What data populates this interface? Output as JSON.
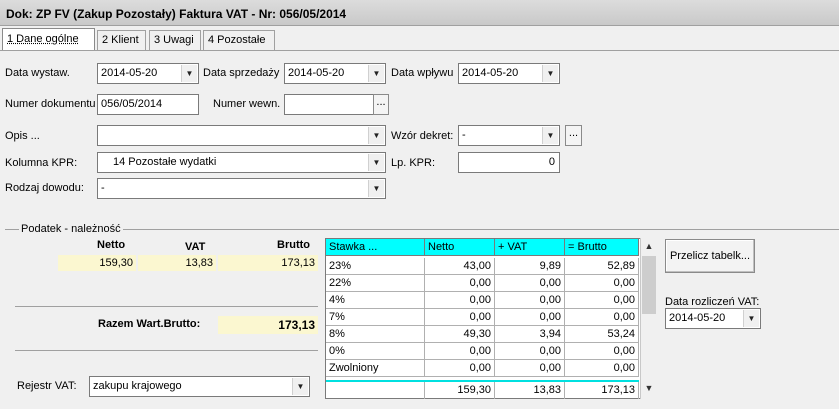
{
  "window": {
    "title": "Dok: ZP FV (Zakup Pozostały)  Faktura VAT  - Nr: 056/05/2014"
  },
  "tabs": [
    {
      "label": "1 Dane ogólne",
      "active": true
    },
    {
      "label": "2 Klient"
    },
    {
      "label": "3 Uwagi"
    },
    {
      "label": "4 Pozostałe"
    }
  ],
  "form": {
    "data_wystaw": {
      "label": "Data wystaw.",
      "value": "2014-05-20"
    },
    "data_sprzedazy": {
      "label": "Data sprzedaży",
      "value": "2014-05-20"
    },
    "data_wplywu": {
      "label": "Data wpływu",
      "value": "2014-05-20"
    },
    "numer_dokumentu": {
      "label": "Numer dokumentu",
      "value": "056/05/2014"
    },
    "numer_wewn": {
      "label": "Numer wewn.",
      "value": ""
    },
    "opis": {
      "label": "Opis ...",
      "value": ""
    },
    "wzor_dekret": {
      "label": "Wzór dekret:",
      "value": "-"
    },
    "kolumna_kpr": {
      "label": "Kolumna KPR:",
      "value": "14  Pozostałe wydatki"
    },
    "lp_kpr": {
      "label": "Lp. KPR:",
      "value": "0"
    },
    "rodzaj_dowodu": {
      "label": "Rodzaj dowodu:",
      "value": "-"
    },
    "ellipsis": "..."
  },
  "podatek": {
    "group_label": "Podatek - należność",
    "headers": {
      "netto": "Netto",
      "vat": "VAT",
      "brutto": "Brutto"
    },
    "values": {
      "netto": "159,30",
      "vat": "13,83",
      "brutto": "173,13"
    },
    "razem_label": "Razem Wart.Brutto:",
    "razem_value": "173,13"
  },
  "rejestr": {
    "label": "Rejestr VAT:",
    "value": "zakupu krajowego"
  },
  "vat_table": {
    "headers": [
      "Stawka ...",
      "Netto",
      "+ VAT",
      "= Brutto"
    ],
    "rows": [
      [
        "23%",
        "43,00",
        "9,89",
        "52,89"
      ],
      [
        "22%",
        "0,00",
        "0,00",
        "0,00"
      ],
      [
        "4%",
        "0,00",
        "0,00",
        "0,00"
      ],
      [
        "7%",
        "0,00",
        "0,00",
        "0,00"
      ],
      [
        "8%",
        "49,30",
        "3,94",
        "53,24"
      ],
      [
        "0%",
        "0,00",
        "0,00",
        "0,00"
      ],
      [
        "Zwolniony",
        "0,00",
        "0,00",
        "0,00"
      ]
    ],
    "totals": [
      "",
      "159,30",
      "13,83",
      "173,13"
    ],
    "header_color": "#00ffff"
  },
  "przelicz_button": "Przelicz tabelk...",
  "data_rozliczen": {
    "label": "Data rozliczeń VAT:",
    "value": "2014-05-20"
  },
  "icons": {
    "dropdown": "chevron-down-icon",
    "scroll_up": "scroll-up-icon",
    "scroll_down": "scroll-down-icon"
  }
}
